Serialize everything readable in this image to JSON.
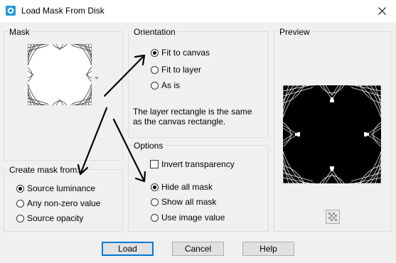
{
  "window": {
    "title": "Load Mask From Disk",
    "close_icon": "close-icon",
    "app_icon": "app-icon"
  },
  "mask": {
    "legend": "Mask",
    "dropdown_icon": "chevron-down-icon"
  },
  "orientation": {
    "legend": "Orientation",
    "options": [
      {
        "label": "Fit to canvas",
        "checked": true
      },
      {
        "label": "Fit to layer",
        "checked": false
      },
      {
        "label": "As is",
        "checked": false
      }
    ],
    "description": "The layer rectangle is the same as the canvas rectangle."
  },
  "options": {
    "legend": "Options",
    "invert_transparency": {
      "label": "Invert transparency",
      "checked": false
    },
    "radios": [
      {
        "label": "Hide all mask",
        "checked": true
      },
      {
        "label": "Show all mask",
        "checked": false
      },
      {
        "label": "Use image value",
        "checked": false
      }
    ]
  },
  "create_mask": {
    "legend": "Create mask from:",
    "options": [
      {
        "label": "Source luminance",
        "checked": true
      },
      {
        "label": "Any non-zero value",
        "checked": false
      },
      {
        "label": "Source opacity",
        "checked": false
      }
    ]
  },
  "preview": {
    "legend": "Preview",
    "toggle_icon": "checkerboard-icon"
  },
  "buttons": {
    "load": "Load",
    "cancel": "Cancel",
    "help": "Help"
  },
  "colors": {
    "accent": "#0078d7",
    "app_icon": "#1f9bd6"
  }
}
